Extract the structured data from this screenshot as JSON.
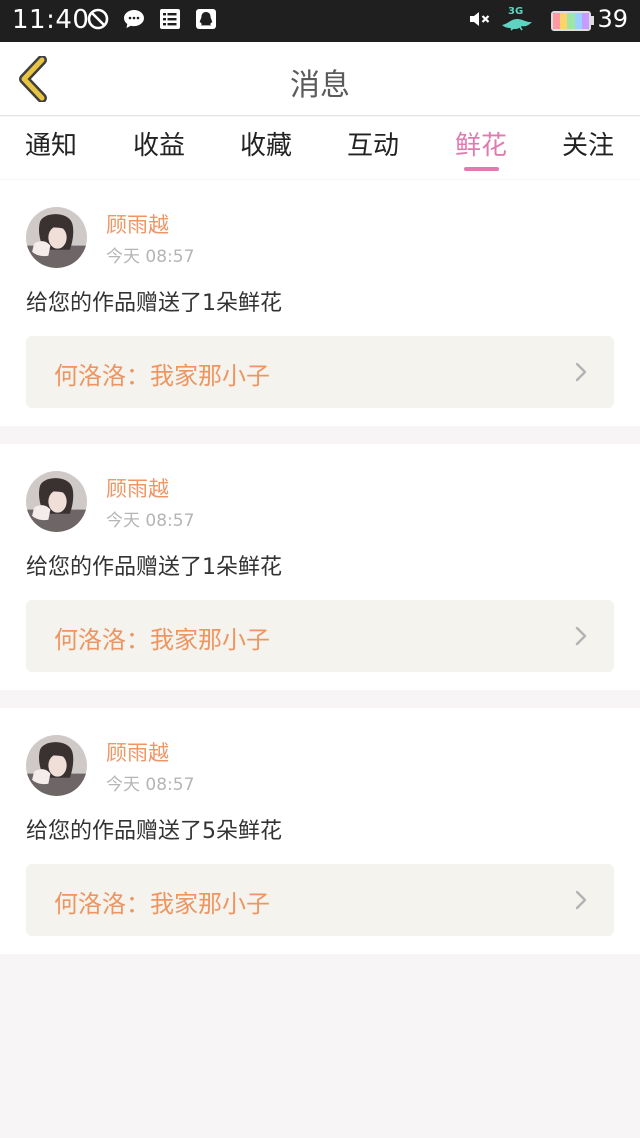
{
  "status_bar": {
    "time": "11:40",
    "battery_level": "39",
    "network_label": "3G",
    "icons": [
      "block-icon",
      "chat-bubble-icon",
      "list-icon",
      "qq-icon",
      "mute-icon",
      "signal-bird-icon",
      "battery-icon"
    ],
    "battery_colors": [
      "#ff9aa2",
      "#ffd36b",
      "#9ee6a8",
      "#9ad0ff",
      "#c79bff",
      "#ffb37a",
      "#f7e36f"
    ]
  },
  "header": {
    "title": "消息",
    "back_icon": "chevron-left-icon",
    "back_color": "#e7c441"
  },
  "tabs": {
    "items": [
      {
        "label": "通知"
      },
      {
        "label": "收益"
      },
      {
        "label": "收藏"
      },
      {
        "label": "互动"
      },
      {
        "label": "鲜花"
      },
      {
        "label": "关注"
      }
    ],
    "active_index": 4,
    "active_color": "#e07bb0"
  },
  "messages": [
    {
      "sender": "顾雨越",
      "time": "今天 08:57",
      "text": "给您的作品赠送了1朵鲜花",
      "work": "何洛洛：我家那小子"
    },
    {
      "sender": "顾雨越",
      "time": "今天 08:57",
      "text": "给您的作品赠送了1朵鲜花",
      "work": "何洛洛：我家那小子"
    },
    {
      "sender": "顾雨越",
      "time": "今天 08:57",
      "text": "给您的作品赠送了5朵鲜花",
      "work": "何洛洛：我家那小子"
    }
  ],
  "colors": {
    "accent_orange": "#f09566",
    "work_text": "#ef9561",
    "quote_bg": "#f4f3ee",
    "page_bg": "#f7f5f5"
  }
}
